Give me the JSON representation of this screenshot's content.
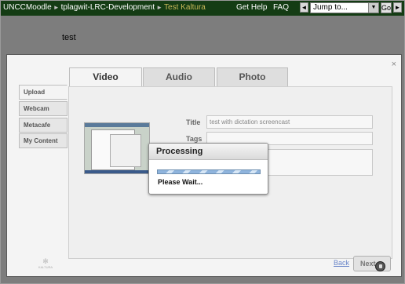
{
  "navbar": {
    "crumbs": [
      "UNCCMoodle",
      "tplagwit-LRC-Development",
      "Test Kaltura"
    ],
    "separator": "►",
    "links": {
      "help": "Get Help",
      "faq": "FAQ"
    },
    "prev_icon": "◄",
    "next_icon": "►",
    "jump": {
      "value": "Jump to...",
      "dropdown_icon": "▼"
    },
    "go_label": "Go",
    "colors": {
      "bar": "#143c14",
      "current_crumb": "#c9b85a"
    }
  },
  "page": {
    "text": "test"
  },
  "modal": {
    "close_icon": "×",
    "tabs": [
      {
        "label": "Video",
        "active": true
      },
      {
        "label": "Audio",
        "active": false
      },
      {
        "label": "Photo",
        "active": false
      }
    ],
    "sources": [
      {
        "label": "Upload",
        "active": true
      },
      {
        "label": "Webcam",
        "active": false
      },
      {
        "label": "Metacafe",
        "active": false
      },
      {
        "label": "My Content",
        "active": false
      }
    ],
    "form": {
      "title_label": "Title",
      "title_value": "test with dictation screencast",
      "tags_label": "Tags"
    },
    "footer": {
      "logo_text": "KALTURA",
      "back_label": "Back",
      "next_label": "Next"
    }
  },
  "processing": {
    "title": "Processing",
    "message": "Please Wait...",
    "colors": {
      "bar": "#8fb4dd"
    }
  }
}
